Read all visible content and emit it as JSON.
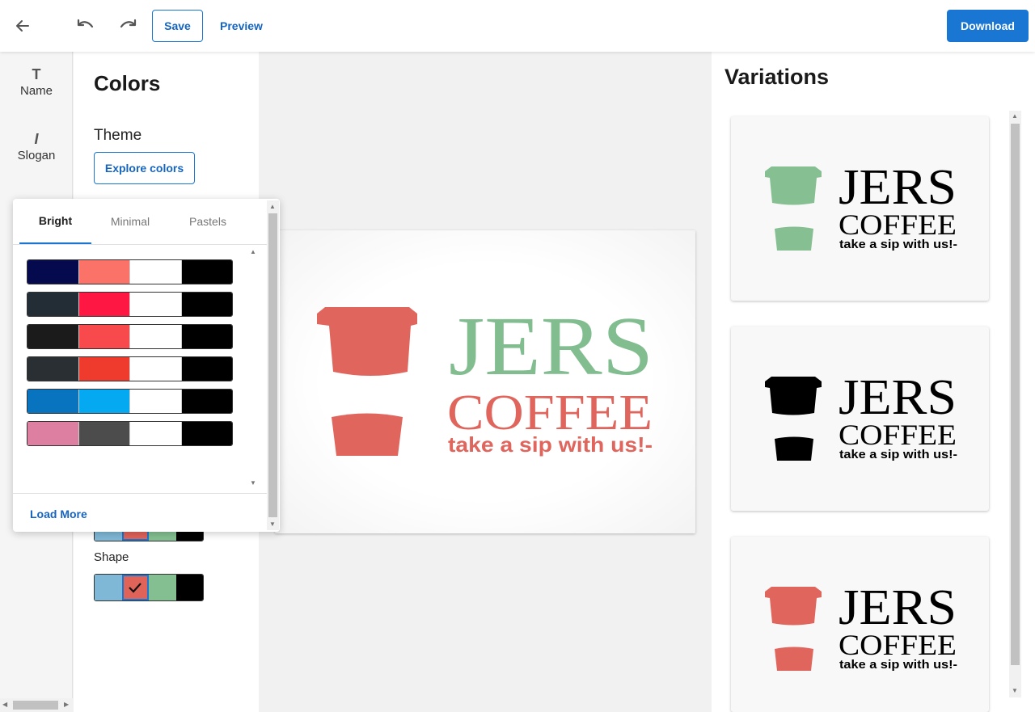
{
  "toolbar": {
    "back_icon": "arrow-left-icon",
    "undo_icon": "undo-icon",
    "redo_icon": "redo-icon",
    "save_label": "Save",
    "preview_label": "Preview",
    "download_label": "Download"
  },
  "rail": {
    "items": [
      {
        "label": "Name",
        "icon": "text-icon",
        "glyph": "T"
      },
      {
        "label": "Slogan",
        "icon": "italic-icon",
        "glyph": "I"
      }
    ]
  },
  "colors_panel": {
    "title": "Colors",
    "theme_label": "Theme",
    "explore_label": "Explore colors",
    "shape_label": "Shape",
    "swatches": [
      "#7fb8d6",
      "#e0635a",
      "#83bf91",
      "#000000"
    ],
    "selected_index": 1
  },
  "popup": {
    "tabs": [
      "Bright",
      "Minimal",
      "Pastels"
    ],
    "active_tab": "Bright",
    "palettes": [
      [
        "#050a4e",
        "#fa7268",
        "#ffffff",
        "#000000"
      ],
      [
        "#232d35",
        "#ff1744",
        "#ffffff",
        "#000000"
      ],
      [
        "#1c1b1c",
        "#f84a4d",
        "#ffffff",
        "#000000"
      ],
      [
        "#2a2f33",
        "#ee3b2e",
        "#ffffff",
        "#000000"
      ],
      [
        "#0874bf",
        "#04a9f2",
        "#ffffff",
        "#000000"
      ],
      [
        "#dd7fa0",
        "#4c4c4c",
        "#ffffff",
        "#000000"
      ]
    ],
    "load_more_label": "Load More"
  },
  "logo": {
    "name": "JERS",
    "word": "COFFEE",
    "slogan": "take a sip with us!-",
    "cup_color": "#e0665d",
    "name_color": "#82bd90",
    "word_color": "#e0665d",
    "slogan_color": "#e0665d"
  },
  "variations": {
    "title": "Variations",
    "items": [
      {
        "cup": "#86bf92",
        "text": "#000000"
      },
      {
        "cup": "#000000",
        "text": "#000000"
      },
      {
        "cup": "#e0665d",
        "text": "#000000"
      }
    ]
  }
}
